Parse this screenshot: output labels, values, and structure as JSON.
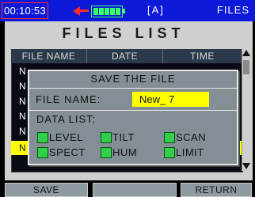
{
  "status": {
    "time": "00:10:53",
    "mode": "[A]",
    "screen": "FILES"
  },
  "window": {
    "title": "FILES LIST",
    "columns": [
      "FILE NAME",
      "DATE",
      "TIME"
    ],
    "visible_rows": [
      "N",
      "N",
      "N",
      "N",
      "N",
      "N"
    ],
    "selected_row_index": 5
  },
  "dialog": {
    "title": "SAVE THE FILE",
    "file_name_label": "FILE NAME:",
    "file_name_value": "New_ 7",
    "data_list_label": "DATA LIST:",
    "items": [
      {
        "label": "LEVEL",
        "checked": true
      },
      {
        "label": "TILT",
        "checked": true
      },
      {
        "label": "SCAN",
        "checked": true
      },
      {
        "label": "SPECT",
        "checked": true
      },
      {
        "label": "HUM",
        "checked": true
      },
      {
        "label": "LIMIT",
        "checked": true
      }
    ]
  },
  "buttons": {
    "left": "SAVE",
    "middle": "",
    "right": "RETURN"
  },
  "colors": {
    "status_bar": "#0d19d8",
    "highlight": "#ffff00",
    "battery": "#3cff6a",
    "alert": "#ff2a2a",
    "checkbox": "#2fcf4a"
  }
}
